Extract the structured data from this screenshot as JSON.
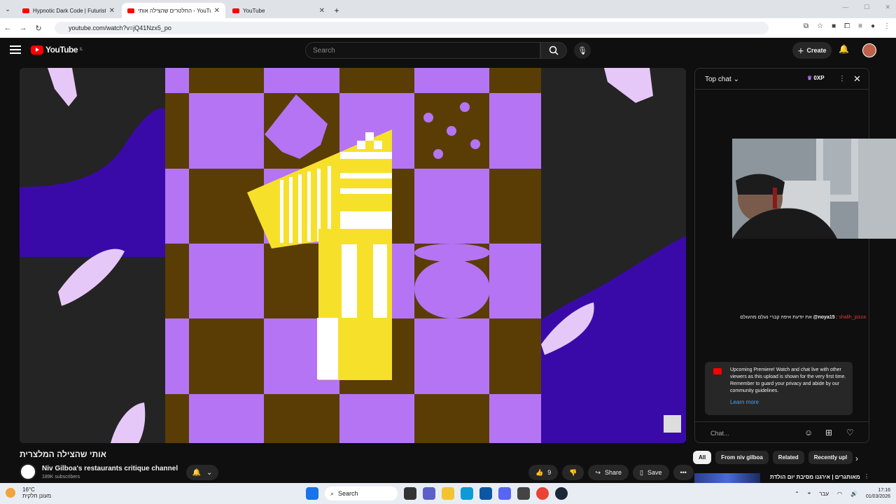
{
  "browser": {
    "tabs": [
      {
        "label": "Hypnotic Dark Code | Futuristic",
        "active": false
      },
      {
        "label": "החלטרים שהצילה אותי - YouTube",
        "active": true
      },
      {
        "label": "YouTube",
        "active": false
      }
    ],
    "url": "youtube.com/watch?v=jQ41Nzx5_po"
  },
  "header": {
    "logo_text": "YouTube",
    "logo_country": "IL",
    "search_placeholder": "Search",
    "create_label": "Create"
  },
  "video": {
    "title": "אותי שהצילה המלצרית",
    "channel_name": "Niv Gilboa's restaurants critique channel",
    "subscribers": "189K subscribers",
    "like_count": "9",
    "share_label": "Share",
    "save_label": "Save"
  },
  "chat": {
    "mode_label": "Top chat",
    "xp_label": "0XP",
    "message_user": "shalih_pizza",
    "message_mention": "@noya15",
    "message_text": "את יודעת איפה קברי נעלם מהעולם",
    "premiere_text": "Upcoming Premiere! Watch and chat live with other viewers as this upload is shown for the very first time. Remember to guard your privacy and abide by our community guidelines.",
    "learn_more": "Learn more",
    "input_placeholder": "Chat..."
  },
  "chips": [
    "All",
    "From niv gilboa",
    "Related",
    "Recently upl"
  ],
  "related": {
    "title": "מאותגרים | אירגנו מסיבת יום הולדת"
  },
  "taskbar": {
    "temperature": "16°C",
    "weather_text": "מעונן חלקית",
    "search_label": "Search",
    "language": "עבר",
    "time": "17:16",
    "date": "01/03/2026"
  },
  "colors": {
    "purple": "#b574f4",
    "brown": "#5a3d05",
    "yellow": "#f7e02a",
    "indigo": "#3a0aa8",
    "yt_red": "#ff0000"
  }
}
